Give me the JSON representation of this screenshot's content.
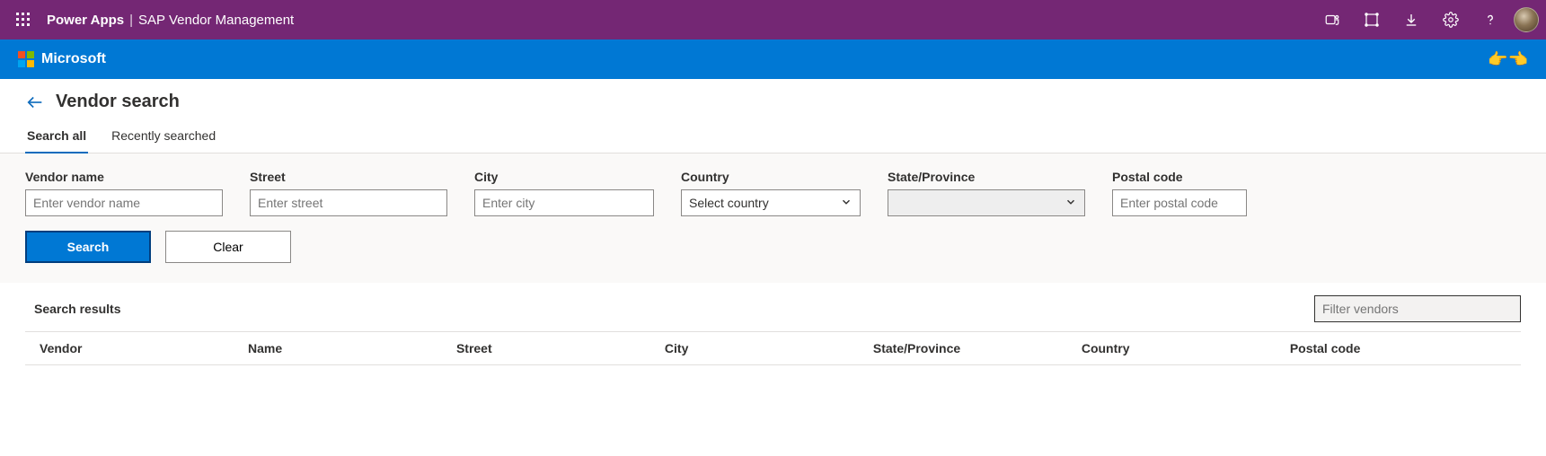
{
  "topbar": {
    "app_name": "Power Apps",
    "separator": "|",
    "page_name": "SAP Vendor Management"
  },
  "brandbar": {
    "logo_text": "Microsoft",
    "right_emoji": "👉👈"
  },
  "header": {
    "title": "Vendor search"
  },
  "tabs": [
    {
      "label": "Search all",
      "active": true
    },
    {
      "label": "Recently searched",
      "active": false
    }
  ],
  "form": {
    "fields": {
      "vendor_name": {
        "label": "Vendor name",
        "placeholder": "Enter vendor name"
      },
      "street": {
        "label": "Street",
        "placeholder": "Enter street"
      },
      "city": {
        "label": "City",
        "placeholder": "Enter city"
      },
      "country": {
        "label": "Country",
        "placeholder": "Select country"
      },
      "state": {
        "label": "State/Province",
        "placeholder": ""
      },
      "postal": {
        "label": "Postal code",
        "placeholder": "Enter postal code"
      }
    },
    "buttons": {
      "search": "Search",
      "clear": "Clear"
    }
  },
  "results": {
    "title": "Search results",
    "filter_placeholder": "Filter vendors",
    "columns": {
      "vendor": "Vendor",
      "name": "Name",
      "street": "Street",
      "city": "City",
      "state": "State/Province",
      "country": "Country",
      "postal": "Postal code"
    }
  }
}
